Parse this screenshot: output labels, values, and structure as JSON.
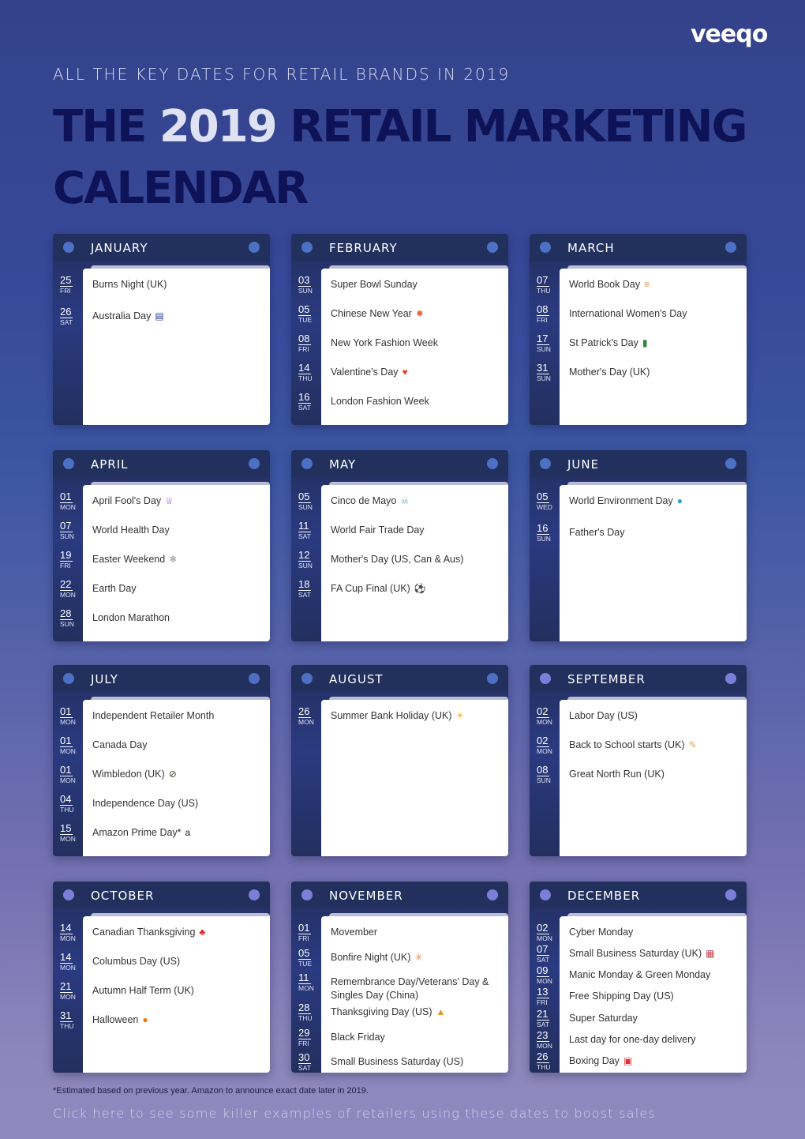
{
  "brand": {
    "logo_text": "veeqo"
  },
  "header": {
    "subtitle": "ALL THE KEY DATES FOR RETAIL BRANDS IN 2019",
    "title_pre": "THE ",
    "title_year": "2019",
    "title_post": " RETAIL MARKETING CALENDAR"
  },
  "colors": {
    "dot_blue": "#4d6fc4",
    "dot_violet": "#7a7fd8",
    "card_dark": "#22305e"
  },
  "months": [
    {
      "name": "JANUARY",
      "events": [
        {
          "day": "25",
          "weekday": "FRI",
          "label": "Burns Night (UK)",
          "icon": ""
        },
        {
          "day": "26",
          "weekday": "SAT",
          "label": "Australia Day",
          "icon": "australia-flag-icon"
        }
      ]
    },
    {
      "name": "FEBRUARY",
      "events": [
        {
          "day": "03",
          "weekday": "SUN",
          "label": "Super Bowl Sunday",
          "icon": ""
        },
        {
          "day": "05",
          "weekday": "TUE",
          "label": "Chinese New Year",
          "icon": "dragon-mask-icon"
        },
        {
          "day": "08",
          "weekday": "FRI",
          "label": "New York Fashion Week",
          "icon": ""
        },
        {
          "day": "14",
          "weekday": "THU",
          "label": "Valentine's Day",
          "icon": "heart-icon"
        },
        {
          "day": "16",
          "weekday": "SAT",
          "label": "London Fashion Week",
          "icon": ""
        }
      ]
    },
    {
      "name": "MARCH",
      "events": [
        {
          "day": "07",
          "weekday": "THU",
          "label": "World Book Day",
          "icon": "books-icon"
        },
        {
          "day": "08",
          "weekday": "FRI",
          "label": "International Women's Day",
          "icon": ""
        },
        {
          "day": "17",
          "weekday": "SUN",
          "label": "St Patrick's Day",
          "icon": "leprechaun-hat-icon"
        },
        {
          "day": "31",
          "weekday": "SUN",
          "label": "Mother's Day (UK)",
          "icon": ""
        }
      ]
    },
    {
      "name": "APRIL",
      "events": [
        {
          "day": "01",
          "weekday": "MON",
          "label": "April Fool's Day",
          "icon": "jester-icon"
        },
        {
          "day": "07",
          "weekday": "SUN",
          "label": "World Health Day",
          "icon": ""
        },
        {
          "day": "19",
          "weekday": "FRI",
          "label": "Easter Weekend",
          "icon": "rabbit-icon"
        },
        {
          "day": "22",
          "weekday": "MON",
          "label": "Earth Day",
          "icon": ""
        },
        {
          "day": "28",
          "weekday": "SUN",
          "label": "London Marathon",
          "icon": ""
        }
      ]
    },
    {
      "name": "MAY",
      "events": [
        {
          "day": "05",
          "weekday": "SUN",
          "label": "Cinco de Mayo",
          "icon": "sugar-skull-icon"
        },
        {
          "day": "11",
          "weekday": "SAT",
          "label": "World Fair Trade Day",
          "icon": ""
        },
        {
          "day": "12",
          "weekday": "SUN",
          "label": "Mother's Day (US, Can & Aus)",
          "icon": ""
        },
        {
          "day": "18",
          "weekday": "SAT",
          "label": "FA Cup Final (UK)",
          "icon": "football-icon"
        }
      ]
    },
    {
      "name": "JUNE",
      "events": [
        {
          "day": "05",
          "weekday": "WED",
          "label": "World Environment Day",
          "icon": "globe-icon"
        },
        {
          "day": "16",
          "weekday": "SUN",
          "label": "Father's Day",
          "icon": ""
        }
      ]
    },
    {
      "name": "JULY",
      "events": [
        {
          "day": "01",
          "weekday": "MON",
          "label": "Independent Retailer Month",
          "icon": ""
        },
        {
          "day": "01",
          "weekday": "MON",
          "label": "Canada Day",
          "icon": ""
        },
        {
          "day": "01",
          "weekday": "MON",
          "label": "Wimbledon (UK)",
          "icon": "tennis-racket-icon"
        },
        {
          "day": "04",
          "weekday": "THU",
          "label": "Independence Day (US)",
          "icon": ""
        },
        {
          "day": "15",
          "weekday": "MON",
          "label": "Amazon Prime Day*",
          "icon": "amazon-icon"
        }
      ]
    },
    {
      "name": "AUGUST",
      "events": [
        {
          "day": "26",
          "weekday": "MON",
          "label": "Summer Bank Holiday (UK)",
          "icon": "sun-icon"
        }
      ]
    },
    {
      "name": "SEPTEMBER",
      "events": [
        {
          "day": "02",
          "weekday": "MON",
          "label": "Labor Day (US)",
          "icon": ""
        },
        {
          "day": "02",
          "weekday": "MON",
          "label": "Back to School starts (UK)",
          "icon": "pencil-icon"
        },
        {
          "day": "08",
          "weekday": "SUN",
          "label": "Great North Run (UK)",
          "icon": ""
        }
      ]
    },
    {
      "name": "OCTOBER",
      "events": [
        {
          "day": "14",
          "weekday": "MON",
          "label": "Canadian Thanksgiving",
          "icon": "maple-leaf-icon"
        },
        {
          "day": "14",
          "weekday": "MON",
          "label": "Columbus Day (US)",
          "icon": ""
        },
        {
          "day": "21",
          "weekday": "MON",
          "label": "Autumn Half Term (UK)",
          "icon": ""
        },
        {
          "day": "31",
          "weekday": "THU",
          "label": "Halloween",
          "icon": "pumpkin-icon"
        }
      ]
    },
    {
      "name": "NOVEMBER",
      "events": [
        {
          "day": "01",
          "weekday": "FRI",
          "label": "Movember",
          "icon": ""
        },
        {
          "day": "05",
          "weekday": "TUE",
          "label": "Bonfire Night (UK)",
          "icon": "fireworks-icon"
        },
        {
          "day": "11",
          "weekday": "MON",
          "label": "Remembrance Day/Veterans' Day & Singles Day (China)",
          "icon": ""
        },
        {
          "day": "28",
          "weekday": "THU",
          "label": "Thanksgiving Day (US)",
          "icon": "turkey-icon"
        },
        {
          "day": "29",
          "weekday": "FRI",
          "label": "Black Friday",
          "icon": ""
        },
        {
          "day": "30",
          "weekday": "SAT",
          "label": "Small Business Saturday (US)",
          "icon": ""
        }
      ]
    },
    {
      "name": "DECEMBER",
      "events": [
        {
          "day": "02",
          "weekday": "MON",
          "label": "Cyber Monday",
          "icon": ""
        },
        {
          "day": "07",
          "weekday": "SAT",
          "label": "Small Business Saturday (UK)",
          "icon": "shop-icon"
        },
        {
          "day": "09",
          "weekday": "MON",
          "label": "Manic Monday & Green Monday",
          "icon": ""
        },
        {
          "day": "13",
          "weekday": "FRI",
          "label": "Free Shipping Day (US)",
          "icon": ""
        },
        {
          "day": "21",
          "weekday": "SAT",
          "label": "Super Saturday",
          "icon": ""
        },
        {
          "day": "23",
          "weekday": "MON",
          "label": "Last day for one-day delivery",
          "icon": ""
        },
        {
          "day": "26",
          "weekday": "THU",
          "label": "Boxing Day",
          "icon": "gift-icon"
        }
      ]
    }
  ],
  "footer": {
    "footnote": "*Estimated based on previous year. Amazon to announce exact date later in 2019.",
    "cta": "Click here to see some killer examples of retailers using these dates to boost sales"
  }
}
